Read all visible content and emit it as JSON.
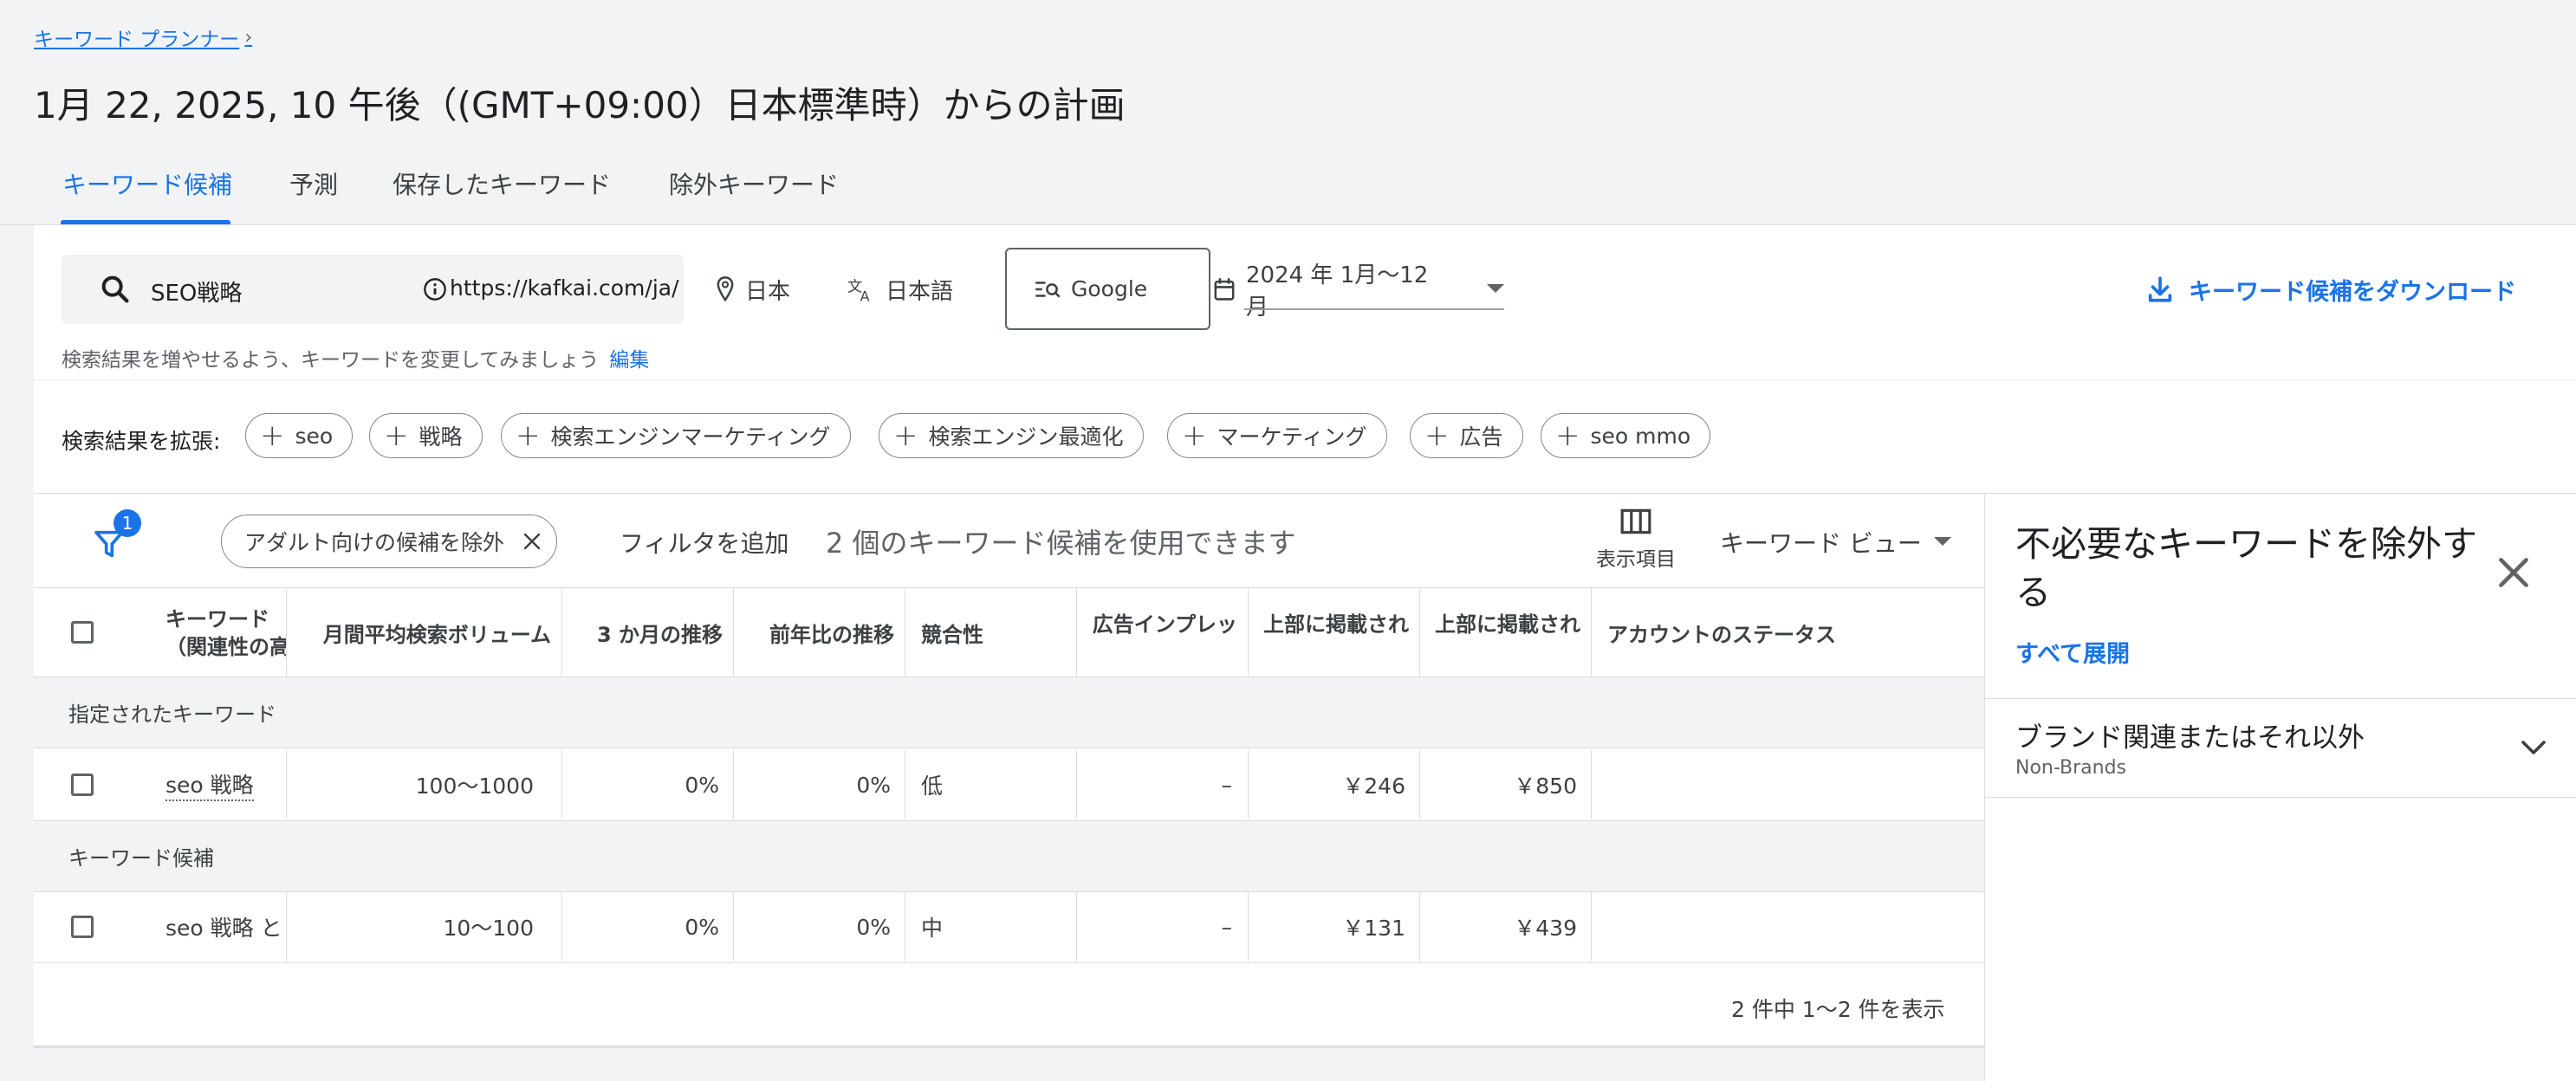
{
  "breadcrumb": {
    "label": "キーワード プランナー"
  },
  "page_title": "1月 22, 2025, 10 午後（(GMT+09:00）日本標準時）からの計画",
  "tabs": [
    {
      "label": "キーワード候補",
      "active": true
    },
    {
      "label": "予測"
    },
    {
      "label": "保存したキーワード"
    },
    {
      "label": "除外キーワード"
    }
  ],
  "search": {
    "keyword": "SEO戦略",
    "url": "https://kafkai.com/ja/",
    "location": "日本",
    "language": "日本語",
    "network": "Google",
    "date_range": "2024 年 1月～12月",
    "download_label": "キーワード候補をダウンロード",
    "hint": "検索結果を増やせるよう、キーワードを変更してみましょう",
    "edit_label": "編集"
  },
  "broaden": {
    "label": "検索結果を拡張:",
    "chips": [
      "seo",
      "戦略",
      "検索エンジンマーケティング",
      "検索エンジン最適化",
      "マーケティング",
      "広告",
      "seo mmo"
    ]
  },
  "toolbar": {
    "filter_count": "1",
    "adult_chip": "アダルト向けの候補を除外",
    "add_filter": "フィルタを追加",
    "available": "2 個のキーワード候補を使用できます",
    "columns_label": "表示項目",
    "view_label": "キーワード ビュー"
  },
  "table": {
    "headers": {
      "keyword_1": "キーワード",
      "keyword_2": "（関連性の高い",
      "volume": "月間平均検索ボリューム",
      "three_month": "3 か月の推移",
      "yoy": "前年比の推移",
      "competition": "競合性",
      "impression_share": "広告インプレッ",
      "top_bid_low": "上部に掲載され",
      "top_bid_high": "上部に掲載され",
      "account_status": "アカウントのステータス"
    },
    "group_provided": "指定されたキーワード",
    "group_ideas": "キーワード候補",
    "rows": [
      {
        "keyword": "seo 戦略",
        "volume": "100～1000",
        "three_month": "0%",
        "yoy": "0%",
        "competition": "低",
        "impression_share": "–",
        "top_bid_low": "￥246",
        "top_bid_high": "￥850"
      },
      {
        "keyword": "seo 戦略 と は",
        "volume": "10～100",
        "three_month": "0%",
        "yoy": "0%",
        "competition": "中",
        "impression_share": "–",
        "top_bid_low": "￥131",
        "top_bid_high": "￥439"
      }
    ],
    "pagination": "2 件中 1～2 件を表示"
  },
  "panel": {
    "title": "不必要なキーワードを除外する",
    "expand_all": "すべて展開",
    "brand_title": "ブランド関連またはそれ以外",
    "brand_sub": "Non-Brands"
  },
  "colors": {
    "accent": "#1a73e8",
    "background": "#f1f3f4",
    "text": "#202124"
  }
}
